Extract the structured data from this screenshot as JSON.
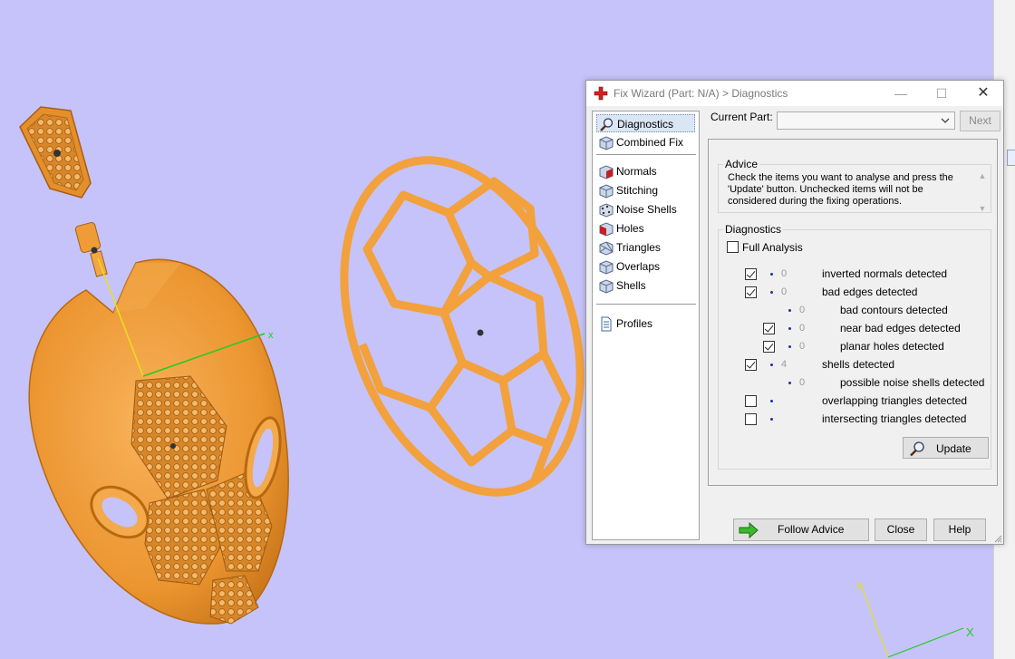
{
  "dialog": {
    "title": "Fix Wizard (Part: N/A) > Diagnostics",
    "window_buttons": {
      "minimize": "—",
      "maximize": "☐",
      "close": "✕"
    }
  },
  "nav": {
    "items": [
      {
        "label": "Diagnostics",
        "icon": "magnifier-icon",
        "selected": true
      },
      {
        "label": "Combined Fix",
        "icon": "cube-icon"
      },
      {
        "label": "Normals",
        "icon": "normals-cube-icon"
      },
      {
        "label": "Stitching",
        "icon": "stitching-cube-icon"
      },
      {
        "label": "Noise Shells",
        "icon": "noise-shells-icon"
      },
      {
        "label": "Holes",
        "icon": "holes-cube-icon"
      },
      {
        "label": "Triangles",
        "icon": "triangles-cube-icon"
      },
      {
        "label": "Overlaps",
        "icon": "overlaps-cube-icon"
      },
      {
        "label": "Shells",
        "icon": "shells-cube-icon"
      },
      {
        "label": "Profiles",
        "icon": "document-icon"
      }
    ]
  },
  "current_part": {
    "label": "Current Part:",
    "value": "",
    "next_label": "Next"
  },
  "advice": {
    "legend": "Advice",
    "text": "Check the items you want to analyse and press the 'Update' button. Unchecked items will not be considered during the fixing operations."
  },
  "diagnostics": {
    "legend": "Diagnostics",
    "full_analysis_label": "Full Analysis",
    "full_analysis_checked": false,
    "rows": [
      {
        "label": "inverted normals detected",
        "count": "0",
        "checked": true,
        "has_checkbox": true,
        "indent": 0
      },
      {
        "label": "bad edges detected",
        "count": "0",
        "checked": true,
        "has_checkbox": true,
        "indent": 0
      },
      {
        "label": "bad contours detected",
        "count": "0",
        "checked": false,
        "has_checkbox": false,
        "indent": 1
      },
      {
        "label": "near bad edges detected",
        "count": "0",
        "checked": true,
        "has_checkbox": true,
        "indent": 1
      },
      {
        "label": "planar holes detected",
        "count": "0",
        "checked": true,
        "has_checkbox": true,
        "indent": 1
      },
      {
        "label": "shells detected",
        "count": "4",
        "checked": true,
        "has_checkbox": true,
        "indent": 0
      },
      {
        "label": "possible noise shells detected",
        "count": "0",
        "checked": false,
        "has_checkbox": false,
        "indent": 1
      },
      {
        "label": "overlapping triangles detected",
        "count": "",
        "checked": false,
        "has_checkbox": true,
        "indent": 0
      },
      {
        "label": "intersecting triangles detected",
        "count": "",
        "checked": false,
        "has_checkbox": true,
        "indent": 0
      }
    ],
    "update_label": "Update"
  },
  "footer": {
    "follow_advice_label": "Follow Advice",
    "close_label": "Close",
    "help_label": "Help"
  },
  "viewport": {
    "axis_labels": {
      "x": "X",
      "y": "Y"
    },
    "colors": {
      "background": "#c5c3f9",
      "part": "#f0a23c",
      "part_dark": "#c47514",
      "axis_x": "#22cc22",
      "axis_y": "#e8e020"
    }
  }
}
